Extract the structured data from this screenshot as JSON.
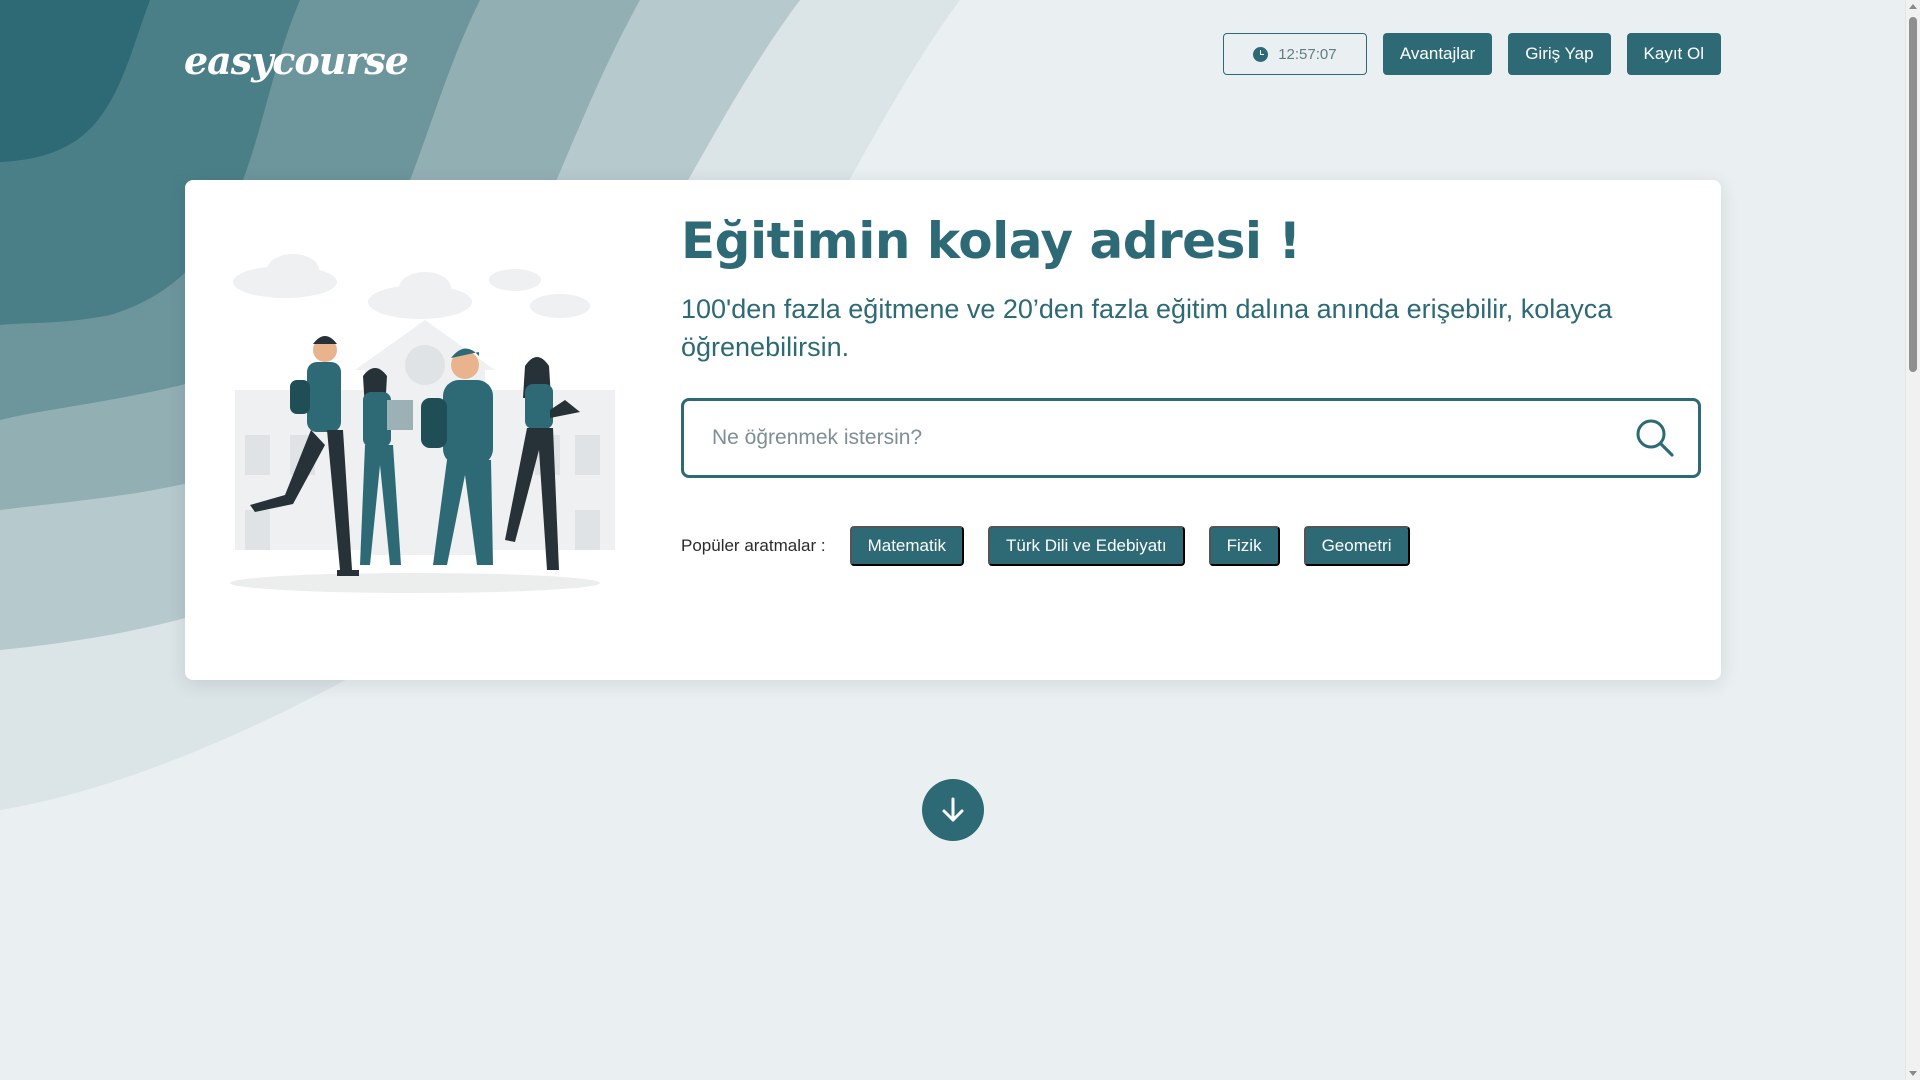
{
  "brand": {
    "logo_text": "easycourse"
  },
  "header": {
    "clock_time": "12:57:07",
    "nav": [
      {
        "label": "Avantajlar"
      },
      {
        "label": "Giriş Yap"
      },
      {
        "label": "Kayıt Ol"
      }
    ]
  },
  "hero": {
    "title": "Eğitimin kolay adresi !",
    "subtitle": "100'den fazla eğitmene ve 20’den fazla eğitim dalına anında erişebilir, kolayca öğrenebilirsin.",
    "search": {
      "placeholder": "Ne öğrenmek istersin?",
      "value": ""
    },
    "popular_label": "Popüler aratmalar :",
    "popular_tags": [
      {
        "label": "Matematik"
      },
      {
        "label": "Türk Dili ve Edebiyatı"
      },
      {
        "label": "Fizik"
      },
      {
        "label": "Geometri"
      }
    ]
  },
  "colors": {
    "primary": "#2d6a75",
    "background": "#eaeff1",
    "card": "#ffffff"
  },
  "icons": {
    "clock": "clock-icon",
    "search": "search-icon",
    "scroll": "arrow-down-icon"
  }
}
